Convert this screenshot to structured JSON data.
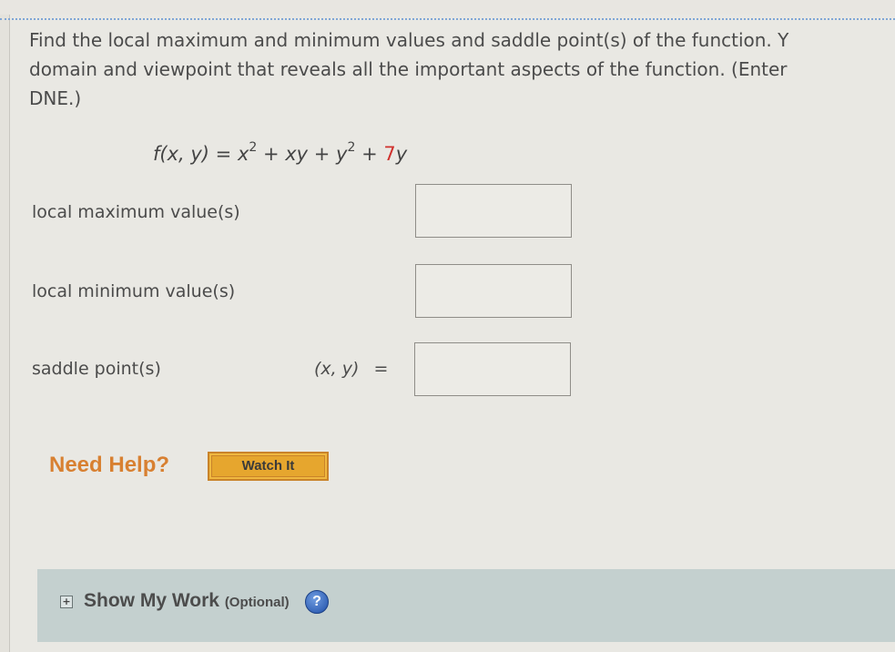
{
  "question": {
    "line1": "Find the local maximum and minimum values and saddle point(s) of the function. Y",
    "line2": "domain and viewpoint that reveals all the important aspects of the function. (Enter",
    "line3": "DNE.)"
  },
  "formula": {
    "lhs": "f(x, y) = ",
    "term1_base": "x",
    "term1_exp": "2",
    "plus1": " + xy + ",
    "term3_base": "y",
    "term3_exp": "2",
    "plus2": " + ",
    "coef": "7",
    "var": "y",
    "highlight_color": "#d0312d"
  },
  "answers": {
    "local_max": {
      "label": "local maximum value(s)",
      "value": ""
    },
    "local_min": {
      "label": "local minimum value(s)",
      "value": ""
    },
    "saddle": {
      "label": "saddle point(s)",
      "prefix": "(x, y)",
      "equals": "=",
      "value": ""
    }
  },
  "help": {
    "need_help": "Need Help?",
    "watch_button": "Watch It"
  },
  "show_work": {
    "label": "Show My Work",
    "optional": "(Optional)",
    "expand_icon": "plus-box-icon",
    "help_icon": "?"
  }
}
